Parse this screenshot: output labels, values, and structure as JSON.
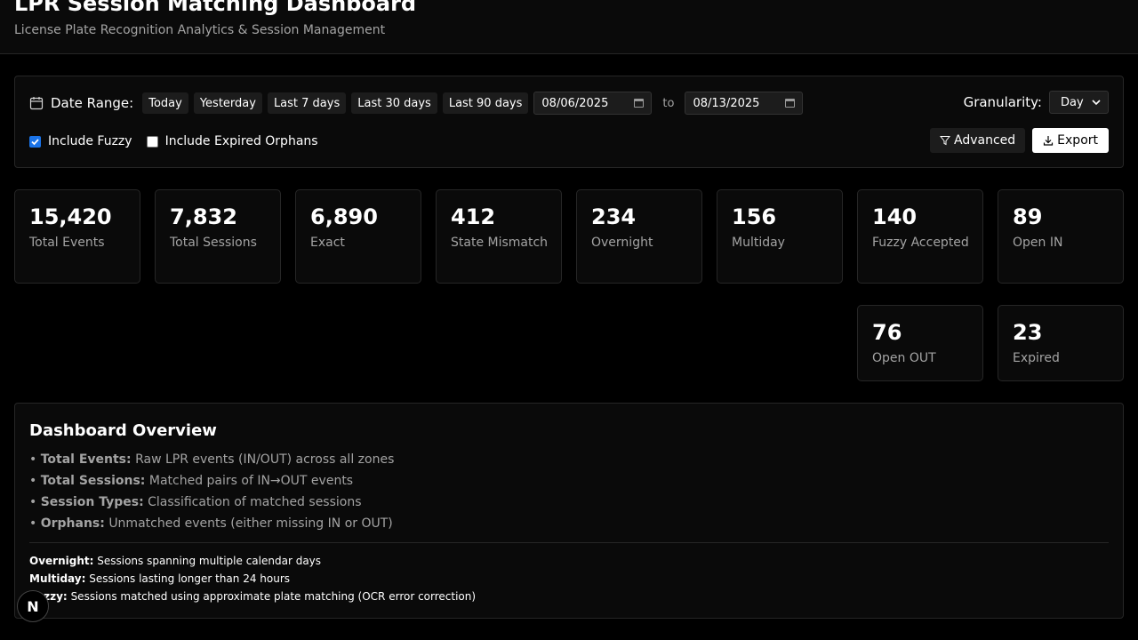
{
  "header": {
    "title": "LPR Session Matching Dashboard",
    "subtitle": "License Plate Recognition Analytics & Session Management"
  },
  "filters": {
    "date_range_label": "Date Range:",
    "presets": [
      "Today",
      "Yesterday",
      "Last 7 days",
      "Last 30 days",
      "Last 90 days"
    ],
    "start_date": "08/06/2025",
    "to_label": "to",
    "end_date": "08/13/2025",
    "granularity_label": "Granularity:",
    "granularity_value": "Day",
    "include_fuzzy_label": "Include Fuzzy",
    "include_fuzzy_checked": true,
    "include_expired_label": "Include Expired Orphans",
    "include_expired_checked": false,
    "advanced_label": "Advanced",
    "export_label": "Export"
  },
  "stats": [
    {
      "value": "15,420",
      "label": "Total Events"
    },
    {
      "value": "7,832",
      "label": "Total Sessions"
    },
    {
      "value": "6,890",
      "label": "Exact"
    },
    {
      "value": "412",
      "label": "State Mismatch"
    },
    {
      "value": "234",
      "label": "Overnight"
    },
    {
      "value": "156",
      "label": "Multiday"
    },
    {
      "value": "140",
      "label": "Fuzzy Accepted"
    },
    {
      "value": "89",
      "label": "Open IN"
    },
    {
      "value": "76",
      "label": "Open OUT"
    },
    {
      "value": "23",
      "label": "Expired"
    }
  ],
  "overview": {
    "title": "Dashboard Overview",
    "items": [
      {
        "term": "Total Events:",
        "desc": "Raw LPR events (IN/OUT) across all zones"
      },
      {
        "term": "Total Sessions:",
        "desc": "Matched pairs of IN→OUT events"
      },
      {
        "term": "Session Types:",
        "desc": "Classification of matched sessions"
      },
      {
        "term": "Orphans:",
        "desc": "Unmatched events (either missing IN or OUT)"
      }
    ],
    "notes": [
      {
        "term": "Overnight:",
        "desc": "Sessions spanning multiple calendar days"
      },
      {
        "term": "Multiday:",
        "desc": "Sessions lasting longer than 24 hours"
      },
      {
        "term": "Fuzzy:",
        "desc": "Sessions matched using approximate plate matching (OCR error correction)"
      }
    ]
  },
  "badge": {
    "letter": "N"
  }
}
